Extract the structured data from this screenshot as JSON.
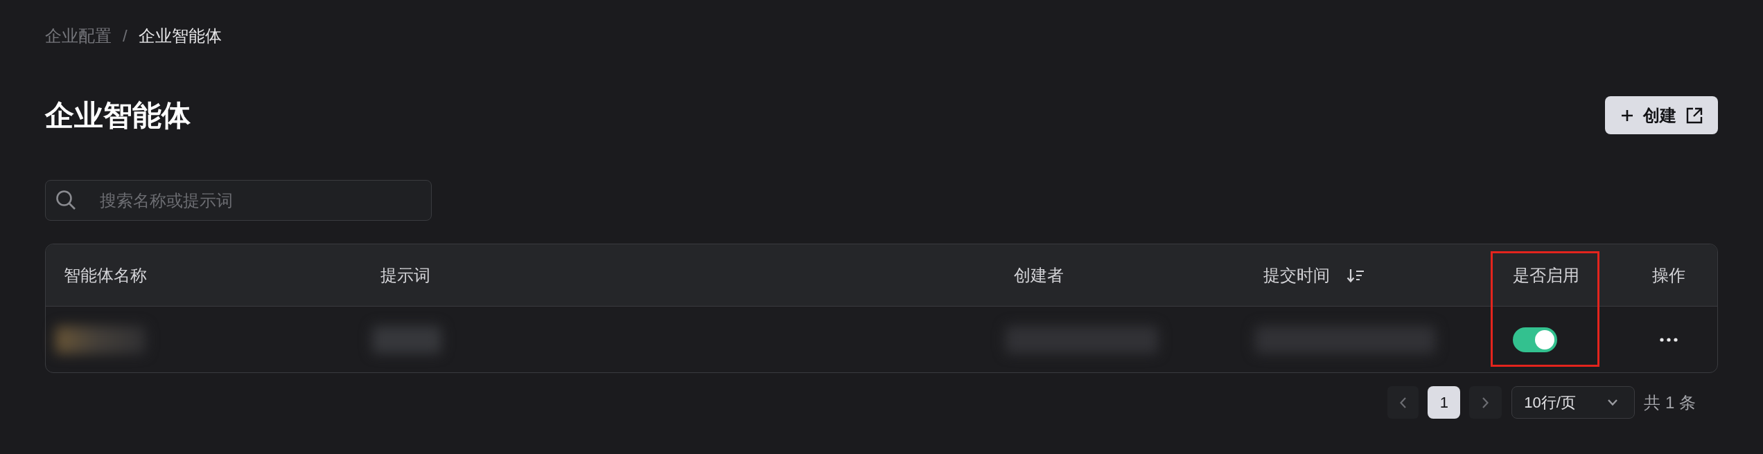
{
  "breadcrumb": {
    "items": [
      {
        "label": "企业配置",
        "current": false
      },
      {
        "label": "企业智能体",
        "current": true
      }
    ],
    "separator": "/"
  },
  "page_title": "企业智能体",
  "create_button": {
    "label": "创建"
  },
  "search": {
    "placeholder": "搜索名称或提示词"
  },
  "table": {
    "columns": [
      {
        "label": "智能体名称",
        "kind": "text",
        "sortable": false,
        "highlighted": false
      },
      {
        "label": "提示词",
        "kind": "text",
        "sortable": false,
        "highlighted": false
      },
      {
        "label": "创建者",
        "kind": "text",
        "sortable": false,
        "highlighted": false
      },
      {
        "label": "提交时间",
        "kind": "text",
        "sortable": true,
        "highlighted": false
      },
      {
        "label": "是否启用",
        "kind": "toggle",
        "sortable": false,
        "highlighted": true
      },
      {
        "label": "操作",
        "kind": "actions",
        "sortable": false,
        "highlighted": false
      }
    ],
    "rows": [
      {
        "enabled": true
      }
    ]
  },
  "pagination": {
    "pages": [
      {
        "label": "1",
        "selected": true
      }
    ],
    "page_size": "10行/页",
    "total": "共 1 条"
  }
}
